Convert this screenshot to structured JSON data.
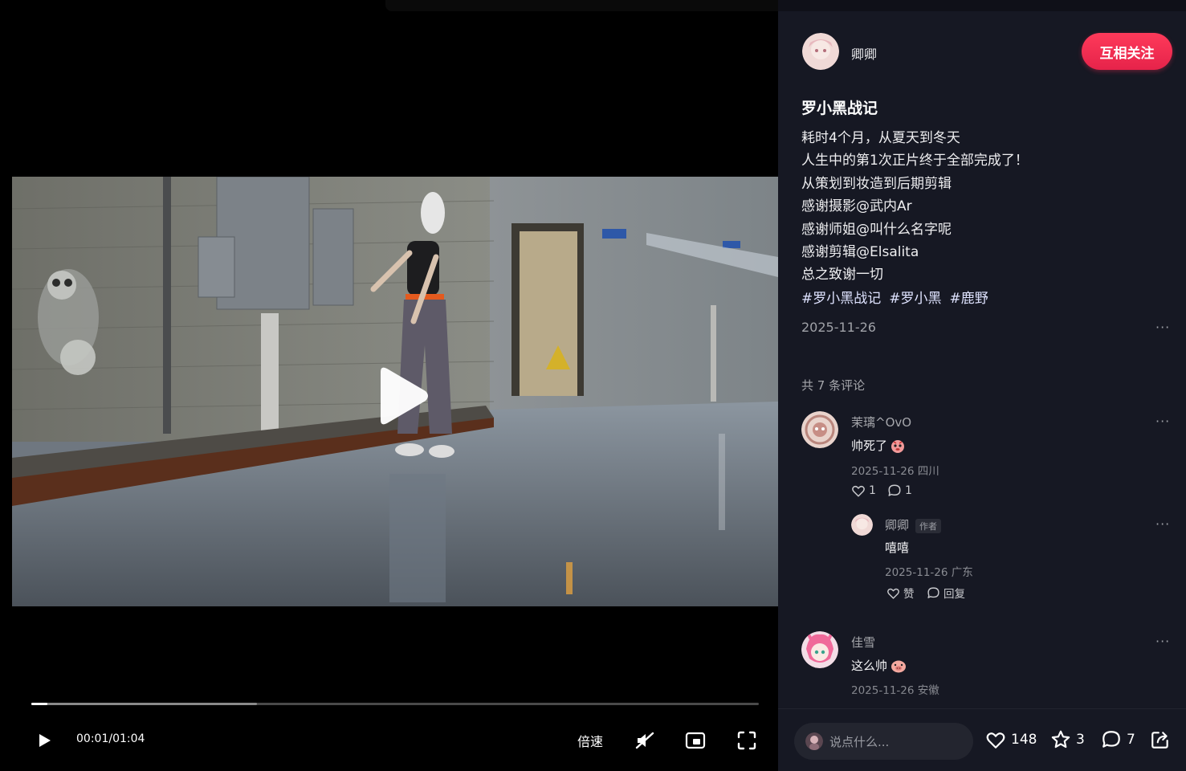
{
  "player": {
    "time_display": "00:01/01:04",
    "speed_label": "倍速",
    "progress": 0.022,
    "buffered": 0.31
  },
  "author": {
    "name": "卿卿",
    "follow_label": "互相关注"
  },
  "post": {
    "title": "罗小黑战记",
    "description_lines": [
      "耗时4个月，从夏天到冬天",
      "人生中的第1次正片终于全部完成了！",
      "从策划到妆造到后期剪辑",
      "感谢摄影@武内Ar",
      "感谢师姐@叫什么名字呢",
      "感谢剪辑@Elsalita",
      "总之致谢一切"
    ],
    "tags": [
      "#罗小黑战记",
      "#罗小黑",
      "#鹿野"
    ],
    "date": "2025-11-26",
    "more_label": "···"
  },
  "comments": {
    "count_label": "共 7 条评论",
    "items": [
      {
        "name": "茉璃^OvO",
        "text": "帅死了",
        "meta": "2025-11-26 四川",
        "likes": "1",
        "replies": "1",
        "reply": {
          "name": "卿卿",
          "badge": "作者",
          "text": "嘻嘻",
          "meta": "2025-11-26 广东",
          "like_label": "赞",
          "reply_label": "回复"
        }
      },
      {
        "name": "佳雪",
        "text": "这么帅",
        "meta": "2025-11-26 安徽"
      }
    ]
  },
  "bottom": {
    "input_placeholder": "说点什么...",
    "likes": "148",
    "favorites": "3",
    "comments": "7"
  },
  "colors": {
    "accent": "#fe2c55",
    "panel_bg": "#161823"
  }
}
